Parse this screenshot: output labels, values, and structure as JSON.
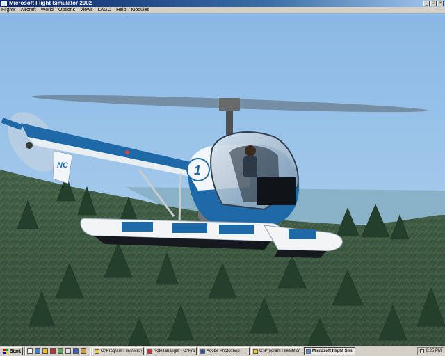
{
  "window": {
    "title": "Microsoft Flight Simulator 2002",
    "buttons": {
      "minimize": "_",
      "maximize": "□",
      "close": "×"
    }
  },
  "menu": {
    "items": [
      "Flights",
      "Aircraft",
      "World",
      "Options",
      "Views",
      "LAGO",
      "Help",
      "Modules"
    ]
  },
  "scene": {
    "aircraft_tail_text": "NC",
    "aircraft_door_number": "1",
    "colors": {
      "sky": "#98c4e8",
      "hull": "#1e6aa8",
      "hill": "#3e5a40"
    }
  },
  "taskbar": {
    "start_label": "Start",
    "tasks": [
      {
        "label": "C:\\Program Files\\Micros...",
        "icon": "folder-icon",
        "active": false
      },
      {
        "label": "NoteTab Light - C:\\Pro...",
        "icon": "notetab-icon",
        "active": false
      },
      {
        "label": "Adobe Photoshop",
        "icon": "photoshop-icon",
        "active": false
      },
      {
        "label": "C:\\Program Files\\Micros...",
        "icon": "folder-icon",
        "active": false
      },
      {
        "label": "Microsoft Flight Sim...",
        "icon": "flight-sim-icon",
        "active": true
      }
    ],
    "clock": "6:25 PM"
  }
}
